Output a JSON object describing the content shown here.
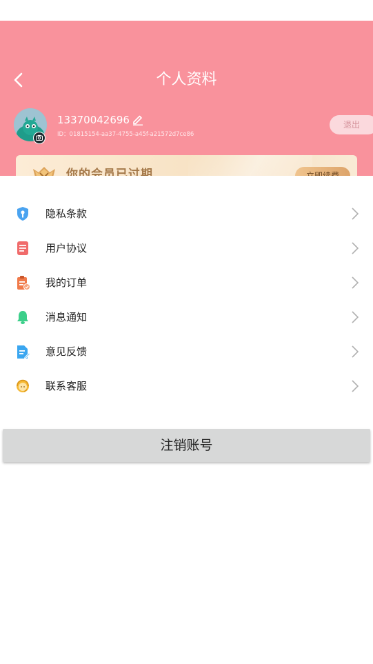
{
  "header": {
    "title": "个人资料",
    "phone": "13370042696",
    "user_id": "ID：01815154-aa37-4755-a45f-a21572d7ce86",
    "logout_label": "退出",
    "icons": {
      "back": "chevron-left-icon",
      "edit": "pencil-icon",
      "camera": "camera-icon"
    }
  },
  "vip": {
    "status_text": "你的会员已过期",
    "renew_label": "立即续费",
    "icon": "crown-icon"
  },
  "menu": {
    "items": [
      {
        "label": "隐私条款",
        "icon": "shield-key-icon",
        "color": "#4aa3f0"
      },
      {
        "label": "用户协议",
        "icon": "document-icon",
        "color": "#f06b6b"
      },
      {
        "label": "我的订单",
        "icon": "clipboard-check-icon",
        "color": "#f07a4a"
      },
      {
        "label": "消息通知",
        "icon": "bell-icon",
        "color": "#3ccf8a"
      },
      {
        "label": "意见反馈",
        "icon": "feedback-edit-icon",
        "color": "#3aa6f0"
      },
      {
        "label": "联系客服",
        "icon": "customer-service-icon",
        "color": "#f5b833"
      }
    ]
  },
  "cancel_account_label": "注销账号",
  "colors": {
    "header_bg": "#f9929c",
    "vip_text": "#a5794a",
    "renew_button": "#dda46a",
    "cancel_button_bg": "#d7d8d8"
  }
}
